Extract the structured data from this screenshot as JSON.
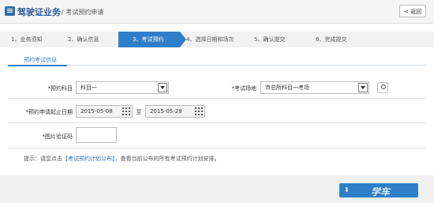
{
  "header": {
    "app_title": "驾驶证业务",
    "sub_title": "/ 考试预约申请",
    "back_label": "返回"
  },
  "steps": [
    {
      "label": "1、业务须知",
      "active": false
    },
    {
      "label": "2、确认信息",
      "active": false
    },
    {
      "label": "3、考试预约",
      "active": true
    },
    {
      "label": "4、选择日期和场次",
      "active": false
    },
    {
      "label": "5、确认提交",
      "active": false
    },
    {
      "label": "6、完成提交",
      "active": false
    }
  ],
  "tab": {
    "label": "预约考试信息"
  },
  "form": {
    "subject_label": "*预约科目",
    "subject_value": "科目一",
    "site_label": "*考试场地",
    "site_value": "市总所科目一考场",
    "date_label": "*预约申请起止日期",
    "date_from": "2015-05-08",
    "date_sep": "至",
    "date_to": "2015-05-28",
    "captcha_label": "*图片验证码",
    "captcha_value": ""
  },
  "hint": {
    "prefix": "提示：请您点击",
    "link": "【考试预约计划公布】",
    "suffix": "，查看当前公布的所有考试预约计划安排。"
  },
  "watermark": "学车",
  "colors": {
    "accent": "#2f7fc8",
    "title": "#2f5f9c"
  }
}
